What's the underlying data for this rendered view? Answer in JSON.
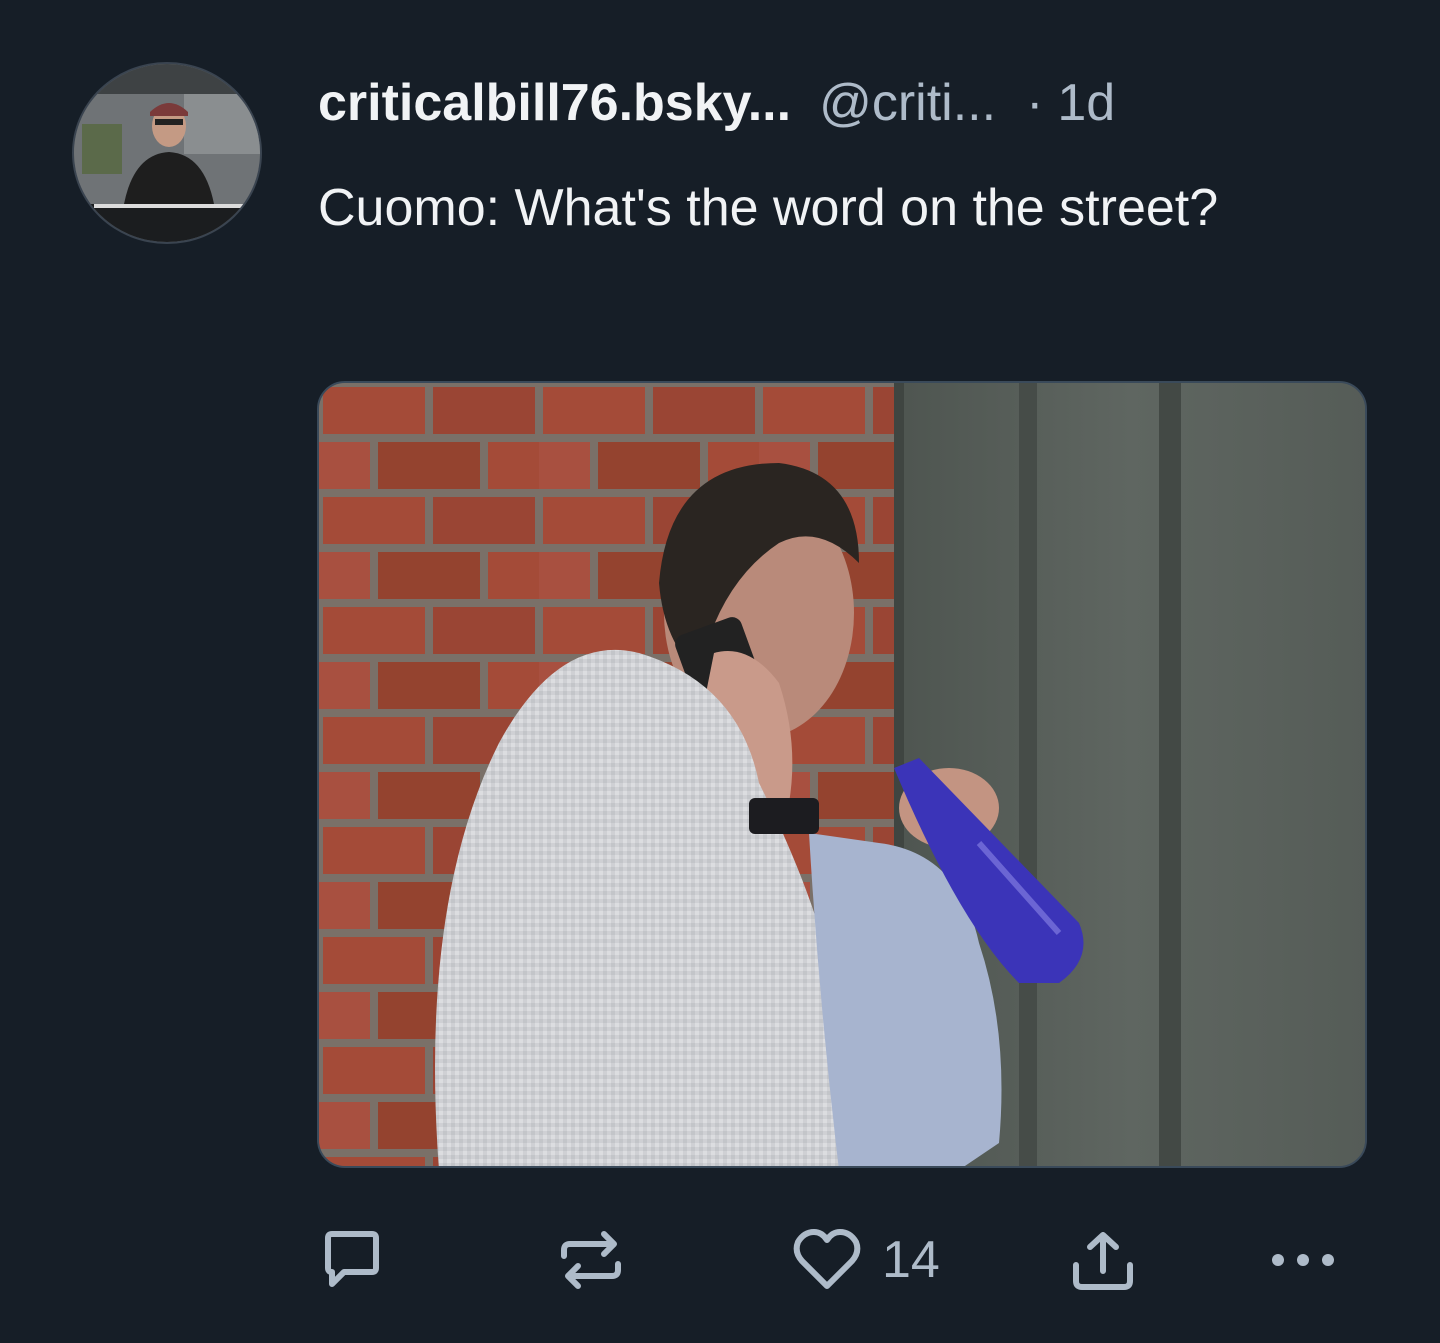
{
  "post": {
    "display_name": "criticalbill76.bsky...",
    "handle": "@criti...",
    "separator": "·",
    "time": "1d",
    "text": "Cuomo: What's the word on the street?",
    "media_alt": ""
  },
  "actions": {
    "reply_icon": "reply-icon",
    "repost_icon": "repost-icon",
    "like_icon": "heart-icon",
    "like_count": "14",
    "share_icon": "share-icon",
    "more_icon": "more-icon"
  },
  "colors": {
    "background": "#161e27",
    "text": "#f1f3f5",
    "muted": "#aebbc9"
  }
}
